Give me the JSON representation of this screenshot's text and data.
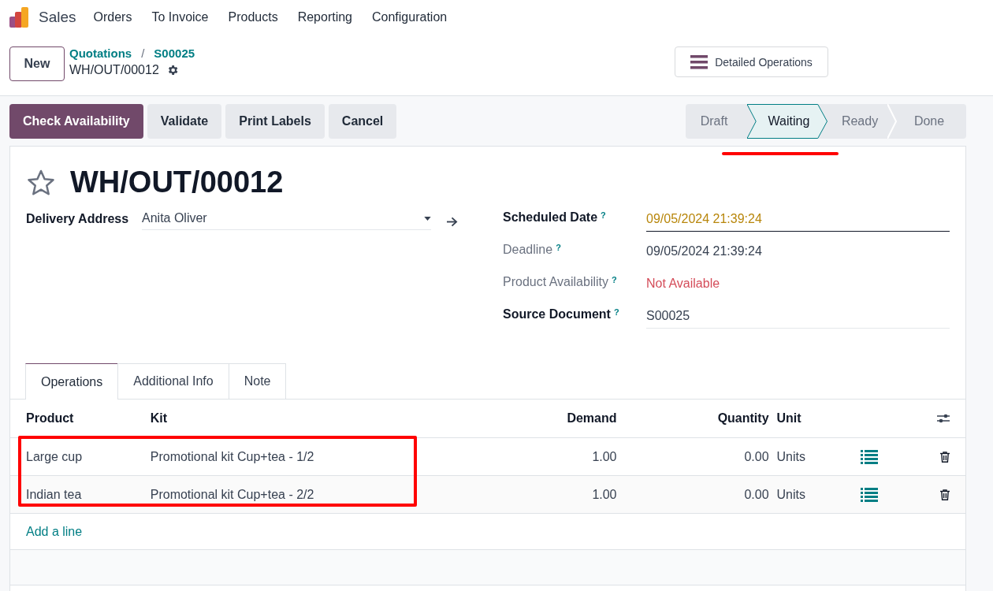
{
  "app": {
    "name": "Sales"
  },
  "menu": [
    "Orders",
    "To Invoice",
    "Products",
    "Reporting",
    "Configuration"
  ],
  "control_panel": {
    "new_button": "New",
    "breadcrumbs": [
      "Quotations",
      "S00025"
    ],
    "separator": "/",
    "record": "WH/OUT/00012",
    "detailed_operations": "Detailed Operations"
  },
  "actions": [
    {
      "label": "Check Availability",
      "primary": true
    },
    {
      "label": "Validate",
      "primary": false
    },
    {
      "label": "Print Labels",
      "primary": false
    },
    {
      "label": "Cancel",
      "primary": false
    }
  ],
  "statusbar": [
    {
      "label": "Draft",
      "selected": false
    },
    {
      "label": "Waiting",
      "selected": true
    },
    {
      "label": "Ready",
      "selected": false
    },
    {
      "label": "Done",
      "selected": false
    }
  ],
  "form": {
    "title": "WH/OUT/00012",
    "starred": false,
    "delivery_address": {
      "label": "Delivery Address",
      "value": "Anita Oliver"
    },
    "fields": [
      {
        "label": "Scheduled Date",
        "help": "?",
        "muted": false,
        "value": "09/05/2024 21:39:24",
        "kind": "warning-date"
      },
      {
        "label": "Deadline",
        "help": "?",
        "muted": true,
        "value": "09/05/2024 21:39:24",
        "kind": "readonly"
      },
      {
        "label": "Product Availability",
        "help": "?",
        "muted": true,
        "value": "Not Available",
        "kind": "danger"
      },
      {
        "label": "Source Document",
        "help": "?",
        "muted": false,
        "value": "S00025",
        "kind": "input"
      }
    ]
  },
  "tabs": [
    {
      "label": "Operations",
      "selected": true
    },
    {
      "label": "Additional Info",
      "selected": false
    },
    {
      "label": "Note",
      "selected": false
    }
  ],
  "table": {
    "columns": [
      "Product",
      "Kit",
      "Demand",
      "Quantity",
      "Unit"
    ],
    "rows": [
      {
        "product": "Large cup",
        "kit": "Promotional kit Cup+tea - 1/2",
        "demand": "1.00",
        "quantity": "0.00",
        "unit": "Units"
      },
      {
        "product": "Indian tea",
        "kit": "Promotional kit Cup+tea - 2/2",
        "demand": "1.00",
        "quantity": "0.00",
        "unit": "Units"
      }
    ],
    "add_line": "Add a line"
  }
}
